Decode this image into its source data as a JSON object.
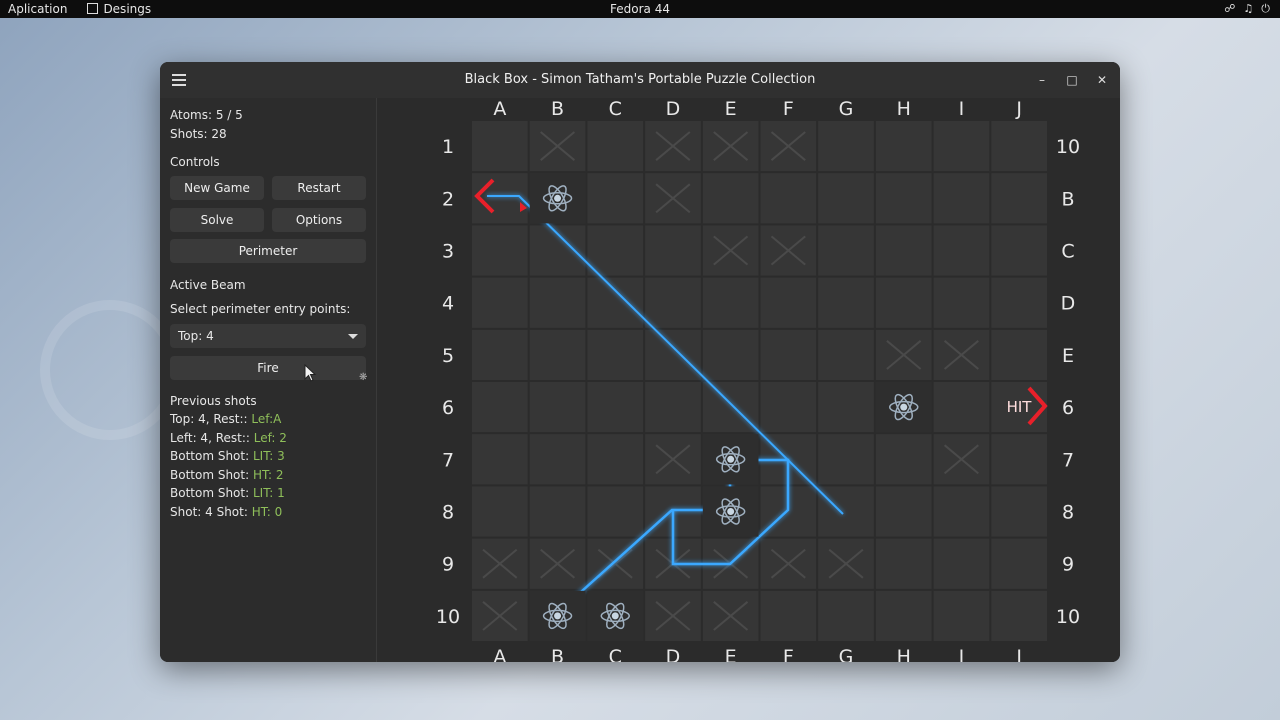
{
  "topbar": {
    "menu_app": "Aplication",
    "menu_designs": "Desings",
    "center": "Fedora 44"
  },
  "window": {
    "title": "Black Box - Simon Tatham's Portable Puzzle Collection"
  },
  "sidebar": {
    "atoms": "Atoms: 5 / 5",
    "shots": "Shots: 28",
    "controls_heading": "Controls",
    "new_game": "New Game",
    "restart": "Restart",
    "solve": "Solve",
    "options": "Options",
    "perimeter": "Perimeter",
    "active_beam_heading": "Active Beam",
    "entry_label": "Select perimeter entry points:",
    "entry_value": "Top: 4",
    "fire": "Fire",
    "previous_heading": "Previous shots",
    "history": [
      {
        "prefix": "Top: 4, Rest:: ",
        "result": "Lef:A"
      },
      {
        "prefix": "Left: 4, Rest:: ",
        "result": "Lef: 2"
      },
      {
        "prefix": "Bottom Shot: ",
        "result": "LIT: 3"
      },
      {
        "prefix": "Bottom Shot: ",
        "result": "HT: 2"
      },
      {
        "prefix": "Bottom Shot: ",
        "result": "LIT: 1"
      },
      {
        "prefix": "Shot: 4 Shot: ",
        "result": "HT: 0"
      }
    ]
  },
  "board": {
    "top_labels": [
      "A",
      "B",
      "C",
      "D",
      "E",
      "F",
      "G",
      "H",
      "I",
      "J"
    ],
    "bottom_labels": [
      "A",
      "B",
      "C",
      "D",
      "E",
      "F",
      "G",
      "H",
      "I",
      "I"
    ],
    "left_labels": [
      "1",
      "2",
      "3",
      "4",
      "5",
      "6",
      "7",
      "8",
      "9",
      "10"
    ],
    "right_labels": [
      "10",
      "B",
      "C",
      "D",
      "E",
      "6",
      "7",
      "8",
      "9",
      "10"
    ],
    "hit_label": "HIT",
    "crossed_cells": [
      [
        0,
        1
      ],
      [
        0,
        3
      ],
      [
        0,
        4
      ],
      [
        0,
        5
      ],
      [
        1,
        3
      ],
      [
        2,
        4
      ],
      [
        2,
        5
      ],
      [
        4,
        7
      ],
      [
        4,
        8
      ],
      [
        6,
        3
      ],
      [
        6,
        8
      ],
      [
        8,
        0
      ],
      [
        8,
        1
      ],
      [
        8,
        2
      ],
      [
        8,
        3
      ],
      [
        8,
        4
      ],
      [
        8,
        5
      ],
      [
        8,
        6
      ],
      [
        9,
        0
      ],
      [
        9,
        3
      ],
      [
        9,
        4
      ]
    ],
    "atoms": [
      [
        1,
        1
      ],
      [
        5,
        7
      ],
      [
        6,
        4
      ],
      [
        7,
        4
      ],
      [
        9,
        1
      ],
      [
        9,
        2
      ]
    ],
    "colors": {
      "beam": "#3aa8ff",
      "hit": "#e8202a"
    }
  }
}
